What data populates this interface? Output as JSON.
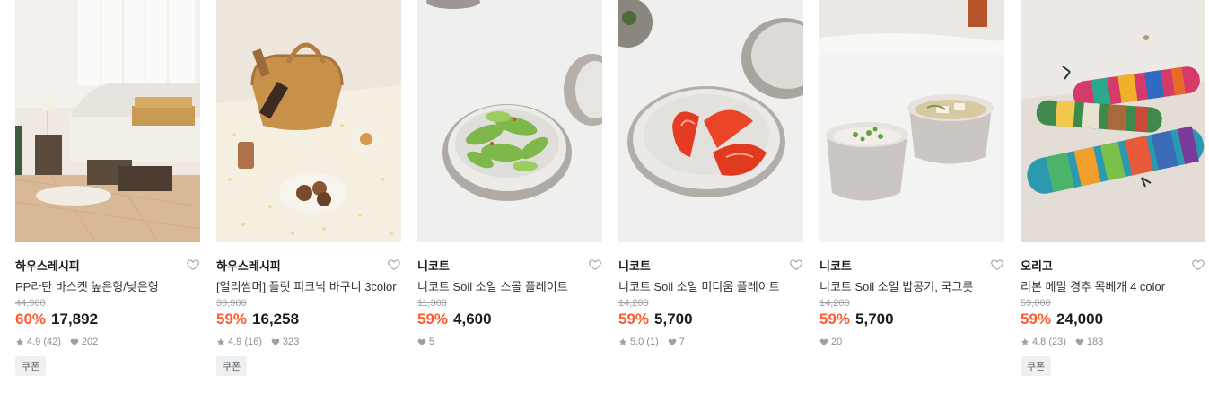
{
  "products": [
    {
      "brand": "하우스레시피",
      "title": "PP라탄 바스켓 높은형/낮은형",
      "original_price": "44,900",
      "discount": "60%",
      "price": "17,892",
      "rating": "4.9 (42)",
      "likes": "202",
      "coupon": "쿠폰"
    },
    {
      "brand": "하우스레시피",
      "title": "[얼리썸머] 플릿 피크닉 바구니 3color",
      "original_price": "39,900",
      "discount": "59%",
      "price": "16,258",
      "rating": "4.9 (16)",
      "likes": "323",
      "coupon": "쿠폰"
    },
    {
      "brand": "니코트",
      "title": "니코트 Soil 소일 스몰 플레이트",
      "original_price": "11,300",
      "discount": "59%",
      "price": "4,600",
      "likes": "5"
    },
    {
      "brand": "니코트",
      "title": "니코트 Soil 소일 미디움 플레이트",
      "original_price": "14,200",
      "discount": "59%",
      "price": "5,700",
      "rating": "5.0 (1)",
      "likes": "7"
    },
    {
      "brand": "니코트",
      "title": "니코트 Soil 소일 밥공기, 국그릇",
      "original_price": "14,200",
      "discount": "59%",
      "price": "5,700",
      "likes": "20"
    },
    {
      "brand": "오리고",
      "title": "리본 메밀 경추 목베개 4 color",
      "original_price": "59,000",
      "discount": "59%",
      "price": "24,000",
      "rating": "4.8 (23)",
      "likes": "183",
      "coupon": "쿠폰"
    }
  ]
}
